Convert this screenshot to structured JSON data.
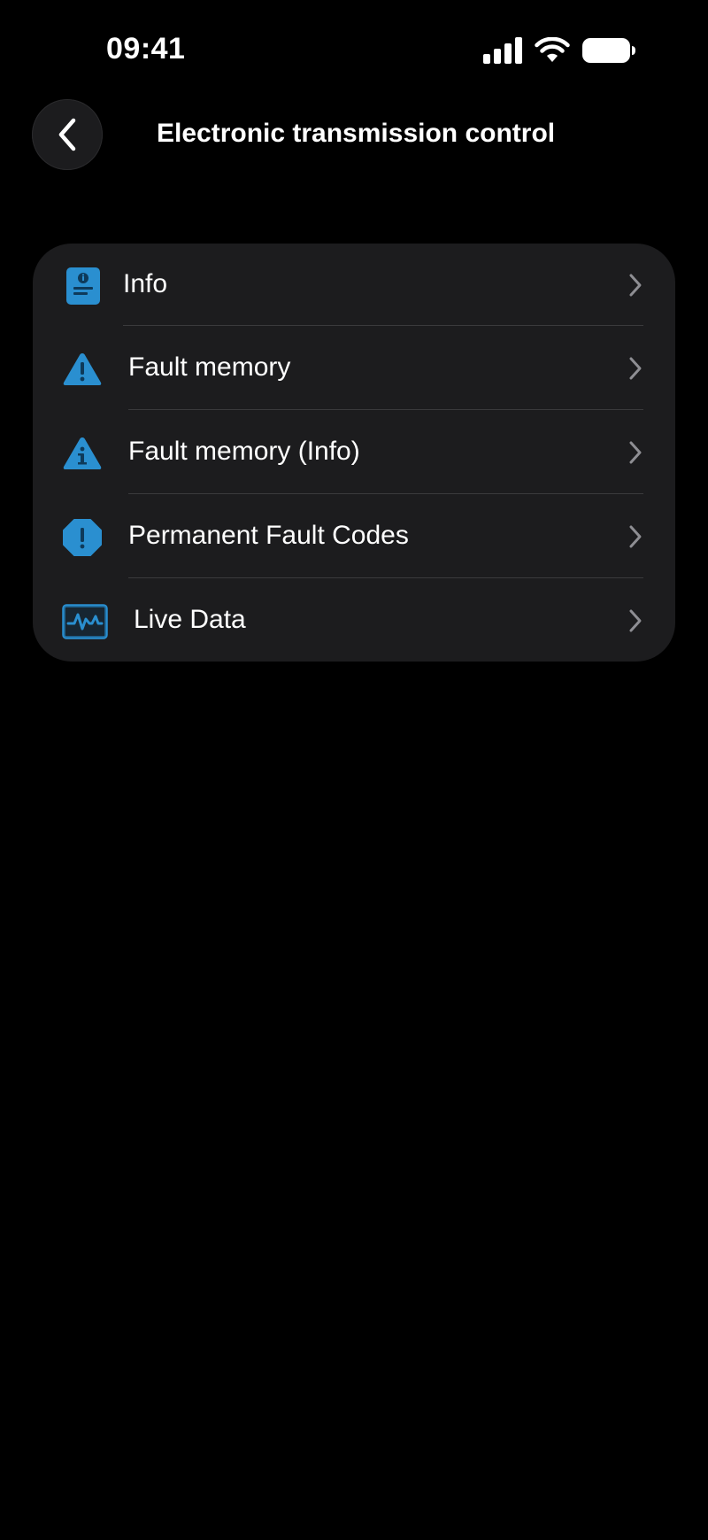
{
  "status_bar": {
    "time": "09:41"
  },
  "header": {
    "title": "Electronic transmission control"
  },
  "menu": {
    "items": [
      {
        "label": "Info",
        "icon": "info-document-icon"
      },
      {
        "label": "Fault memory",
        "icon": "warning-triangle-icon"
      },
      {
        "label": "Fault memory (Info)",
        "icon": "info-triangle-icon"
      },
      {
        "label": "Permanent Fault Codes",
        "icon": "alert-octagon-icon"
      },
      {
        "label": "Live Data",
        "icon": "live-data-graph-icon"
      }
    ]
  },
  "colors": {
    "background": "#000000",
    "card": "#1c1c1e",
    "icon_accent": "#2a8fd0",
    "chevron": "#8e8e93",
    "divider": "#3a3a3c"
  }
}
